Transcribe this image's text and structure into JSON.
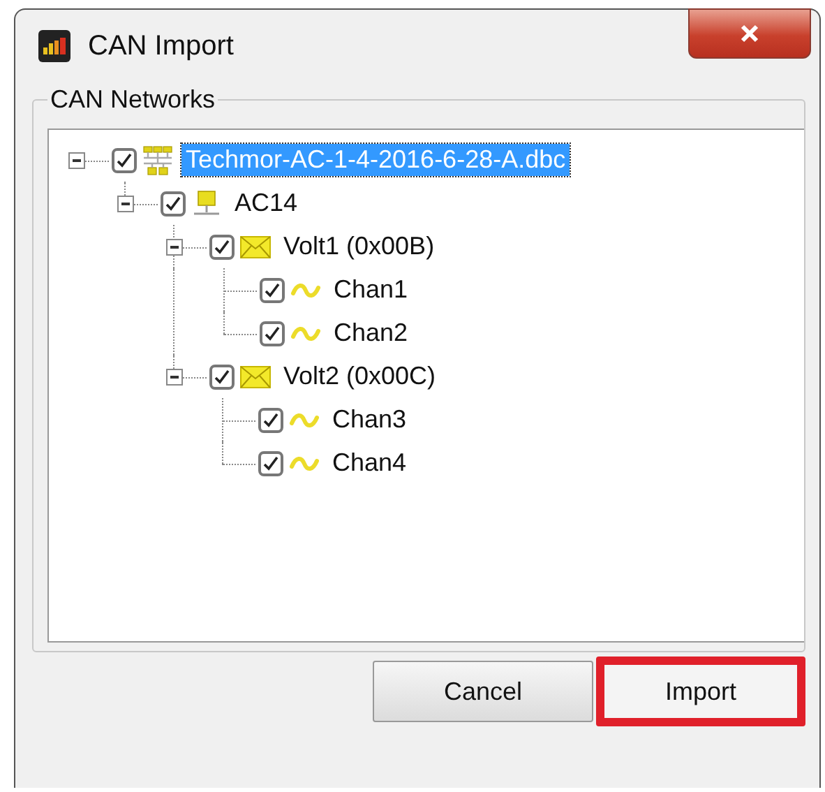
{
  "window": {
    "title": "CAN Import"
  },
  "group": {
    "label": "CAN Networks"
  },
  "tree": [
    {
      "kind": "network",
      "label": "Techmor-AC-1-4-2016-6-28-A.dbc",
      "checked": true,
      "expanded": true,
      "selected": true,
      "children": [
        {
          "kind": "node",
          "label": "AC14",
          "checked": true,
          "expanded": true,
          "selected": false,
          "children": [
            {
              "kind": "message",
              "label": "Volt1 (0x00B)",
              "checked": true,
              "expanded": true,
              "selected": false,
              "children": [
                {
                  "kind": "signal",
                  "label": "Chan1",
                  "checked": true,
                  "selected": false
                },
                {
                  "kind": "signal",
                  "label": "Chan2",
                  "checked": true,
                  "selected": false
                }
              ]
            },
            {
              "kind": "message",
              "label": "Volt2 (0x00C)",
              "checked": true,
              "expanded": true,
              "selected": false,
              "children": [
                {
                  "kind": "signal",
                  "label": "Chan3",
                  "checked": true,
                  "selected": false
                },
                {
                  "kind": "signal",
                  "label": "Chan4",
                  "checked": true,
                  "selected": false
                }
              ]
            }
          ]
        }
      ]
    }
  ],
  "buttons": [
    {
      "label": "Cancel",
      "highlighted": false
    },
    {
      "label": "Import",
      "highlighted": true
    }
  ]
}
